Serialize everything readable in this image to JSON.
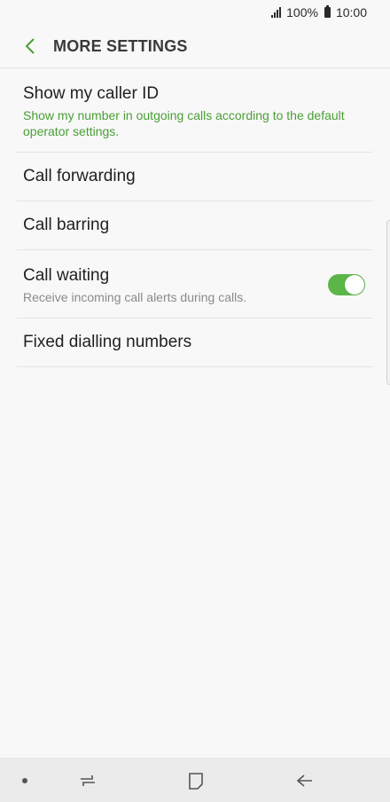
{
  "status_bar": {
    "battery": "100%",
    "time": "10:00"
  },
  "header": {
    "title": "MORE SETTINGS"
  },
  "settings": [
    {
      "title": "Show my caller ID",
      "subtitle": "Show my number in outgoing calls according to the default operator settings."
    },
    {
      "title": "Call forwarding"
    },
    {
      "title": "Call barring"
    },
    {
      "title": "Call waiting",
      "subtitle": "Receive incoming call alerts during calls.",
      "toggle_on": true
    },
    {
      "title": "Fixed dialling numbers"
    }
  ],
  "colors": {
    "accent": "#4a9e36",
    "toggle": "#5cb548",
    "background": "#f8f8f8"
  },
  "nav_icons": [
    "dot-icon",
    "recent-apps-icon",
    "home-icon",
    "back-arrow-icon"
  ]
}
